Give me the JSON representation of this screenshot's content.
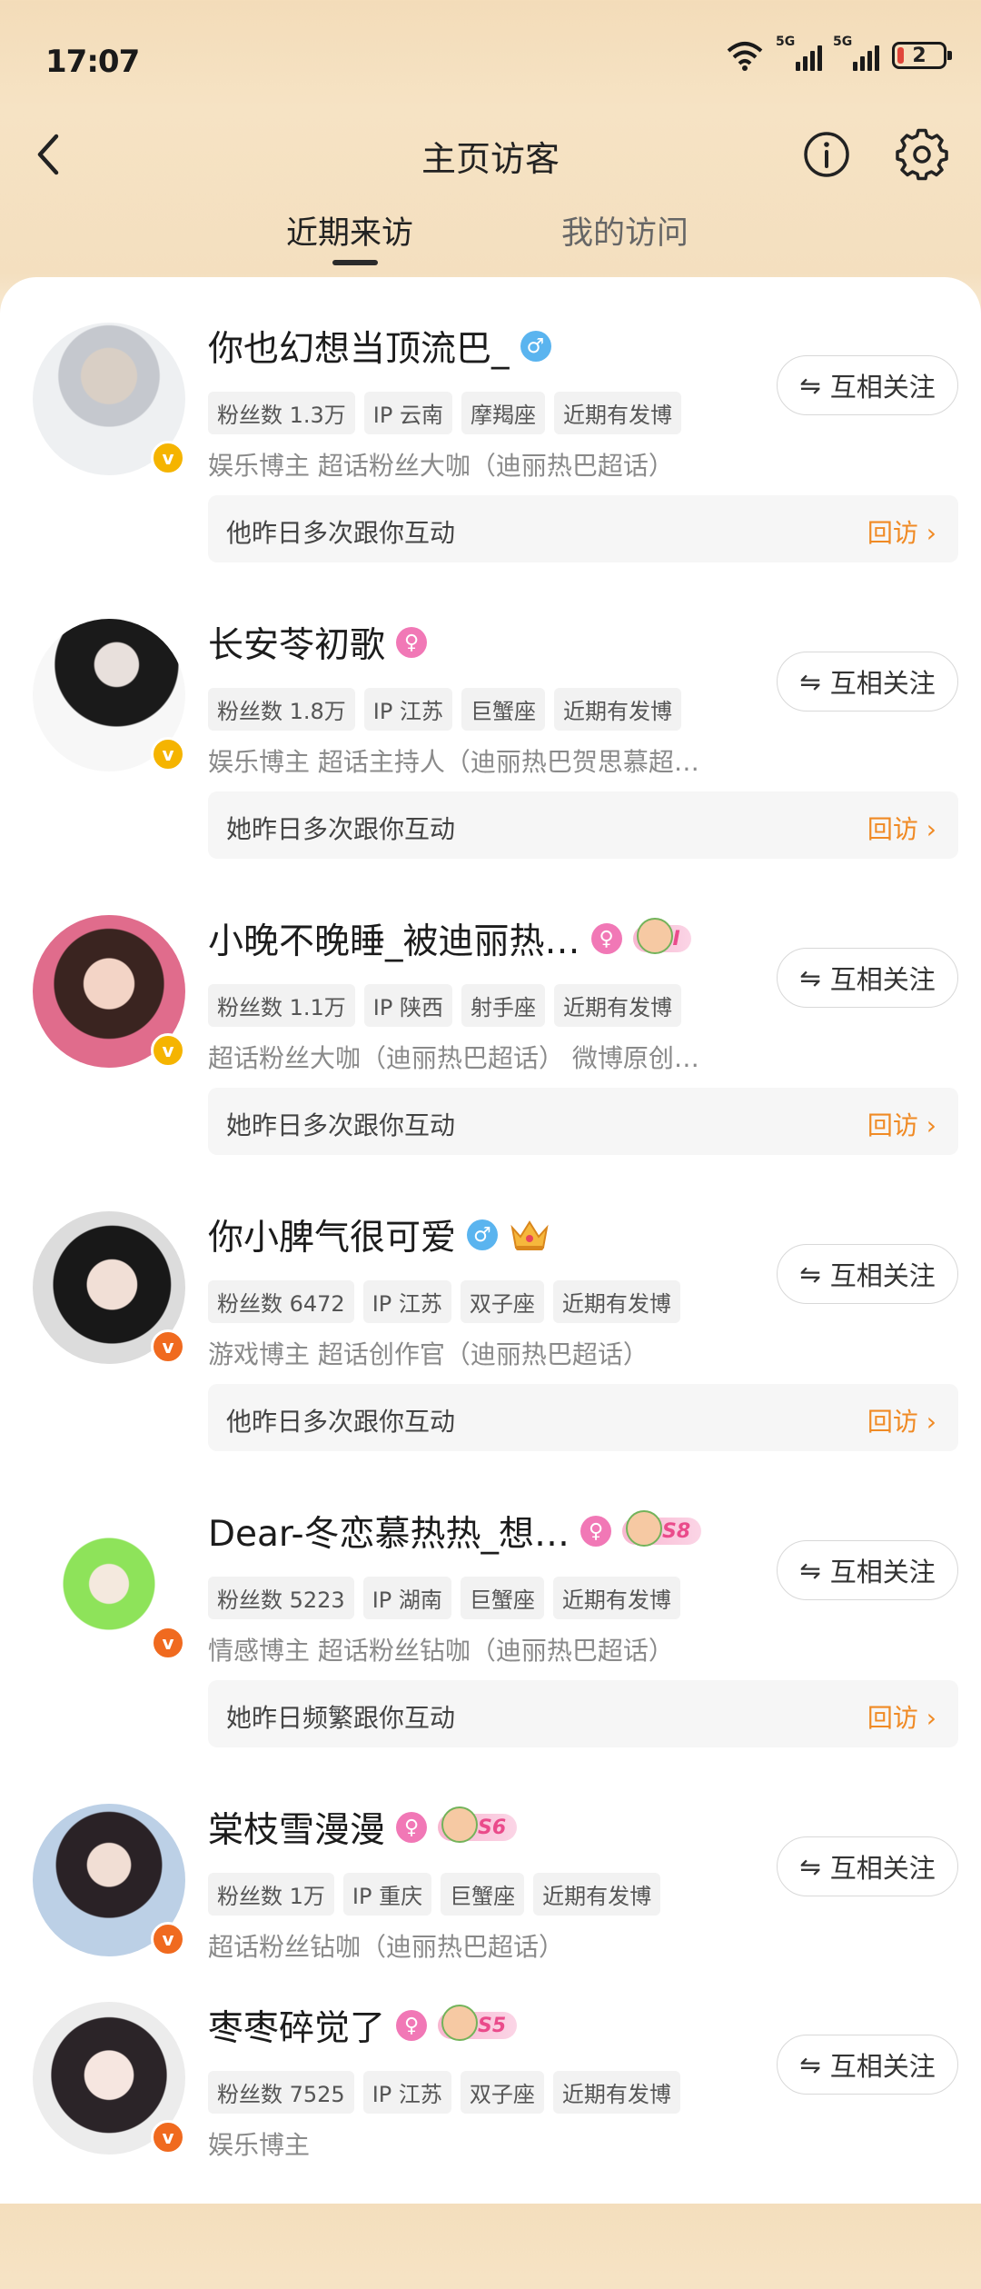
{
  "status": {
    "time": "17:07",
    "battery": "2",
    "sig1": "5G",
    "sig2": "5G"
  },
  "nav": {
    "title": "主页访客"
  },
  "tabs": [
    {
      "label": "近期来访"
    },
    {
      "label": "我的访问"
    }
  ],
  "visitors": [
    {
      "name": "你也幻想当顶流巴_",
      "gender": "♂",
      "tags": [
        "粉丝数 1.3万",
        "IP 云南",
        "摩羯座",
        "近期有发博"
      ],
      "desc": "娱乐博主 超话粉丝大咖（迪丽热巴超话）",
      "interaction": "他昨日多次跟你互动",
      "revisit": "回访 ›",
      "follow": "互相关注",
      "badge_color": "#f5b400"
    },
    {
      "name": "长安苓初歌",
      "gender": "♀",
      "tags": [
        "粉丝数 1.8万",
        "IP 江苏",
        "巨蟹座",
        "近期有发博"
      ],
      "desc": "娱乐博主 超话主持人（迪丽热巴贺思慕超…",
      "interaction": "她昨日多次跟你互动",
      "revisit": "回访 ›",
      "follow": "互相关注",
      "badge_color": "#f5b400"
    },
    {
      "name": "小晚不晚睡_被迪丽热…",
      "gender": "♀",
      "level": "I",
      "tags": [
        "粉丝数 1.1万",
        "IP 陕西",
        "射手座",
        "近期有发博"
      ],
      "desc": "超话粉丝大咖（迪丽热巴超话） 微博原创…",
      "interaction": "她昨日多次跟你互动",
      "revisit": "回访 ›",
      "follow": "互相关注",
      "badge_color": "#f5b400"
    },
    {
      "name": "你小脾气很可爱",
      "gender": "♂",
      "tags": [
        "粉丝数 6472",
        "IP 江苏",
        "双子座",
        "近期有发博"
      ],
      "desc": "游戏博主 超话创作官（迪丽热巴超话）",
      "interaction": "他昨日多次跟你互动",
      "revisit": "回访 ›",
      "follow": "互相关注",
      "badge_color": "#f06a1f"
    },
    {
      "name": "Dear-冬恋慕热热_想…",
      "gender": "♀",
      "level": "S8",
      "tags": [
        "粉丝数 5223",
        "IP 湖南",
        "巨蟹座",
        "近期有发博"
      ],
      "desc": "情感博主 超话粉丝钻咖（迪丽热巴超话）",
      "interaction": "她昨日频繁跟你互动",
      "revisit": "回访 ›",
      "follow": "互相关注",
      "badge_color": "#f06a1f"
    },
    {
      "name": "棠枝雪漫漫",
      "gender": "♀",
      "level": "S6",
      "tags": [
        "粉丝数 1万",
        "IP 重庆",
        "巨蟹座",
        "近期有发博"
      ],
      "desc": "超话粉丝钻咖（迪丽热巴超话）",
      "follow": "互相关注",
      "badge_color": "#f06a1f"
    },
    {
      "name": "枣枣碎觉了",
      "gender": "♀",
      "level": "S5",
      "tags": [
        "粉丝数 7525",
        "IP 江苏",
        "双子座",
        "近期有发博"
      ],
      "desc": "娱乐博主",
      "follow": "互相关注",
      "badge_color": "#f06a1f"
    }
  ]
}
